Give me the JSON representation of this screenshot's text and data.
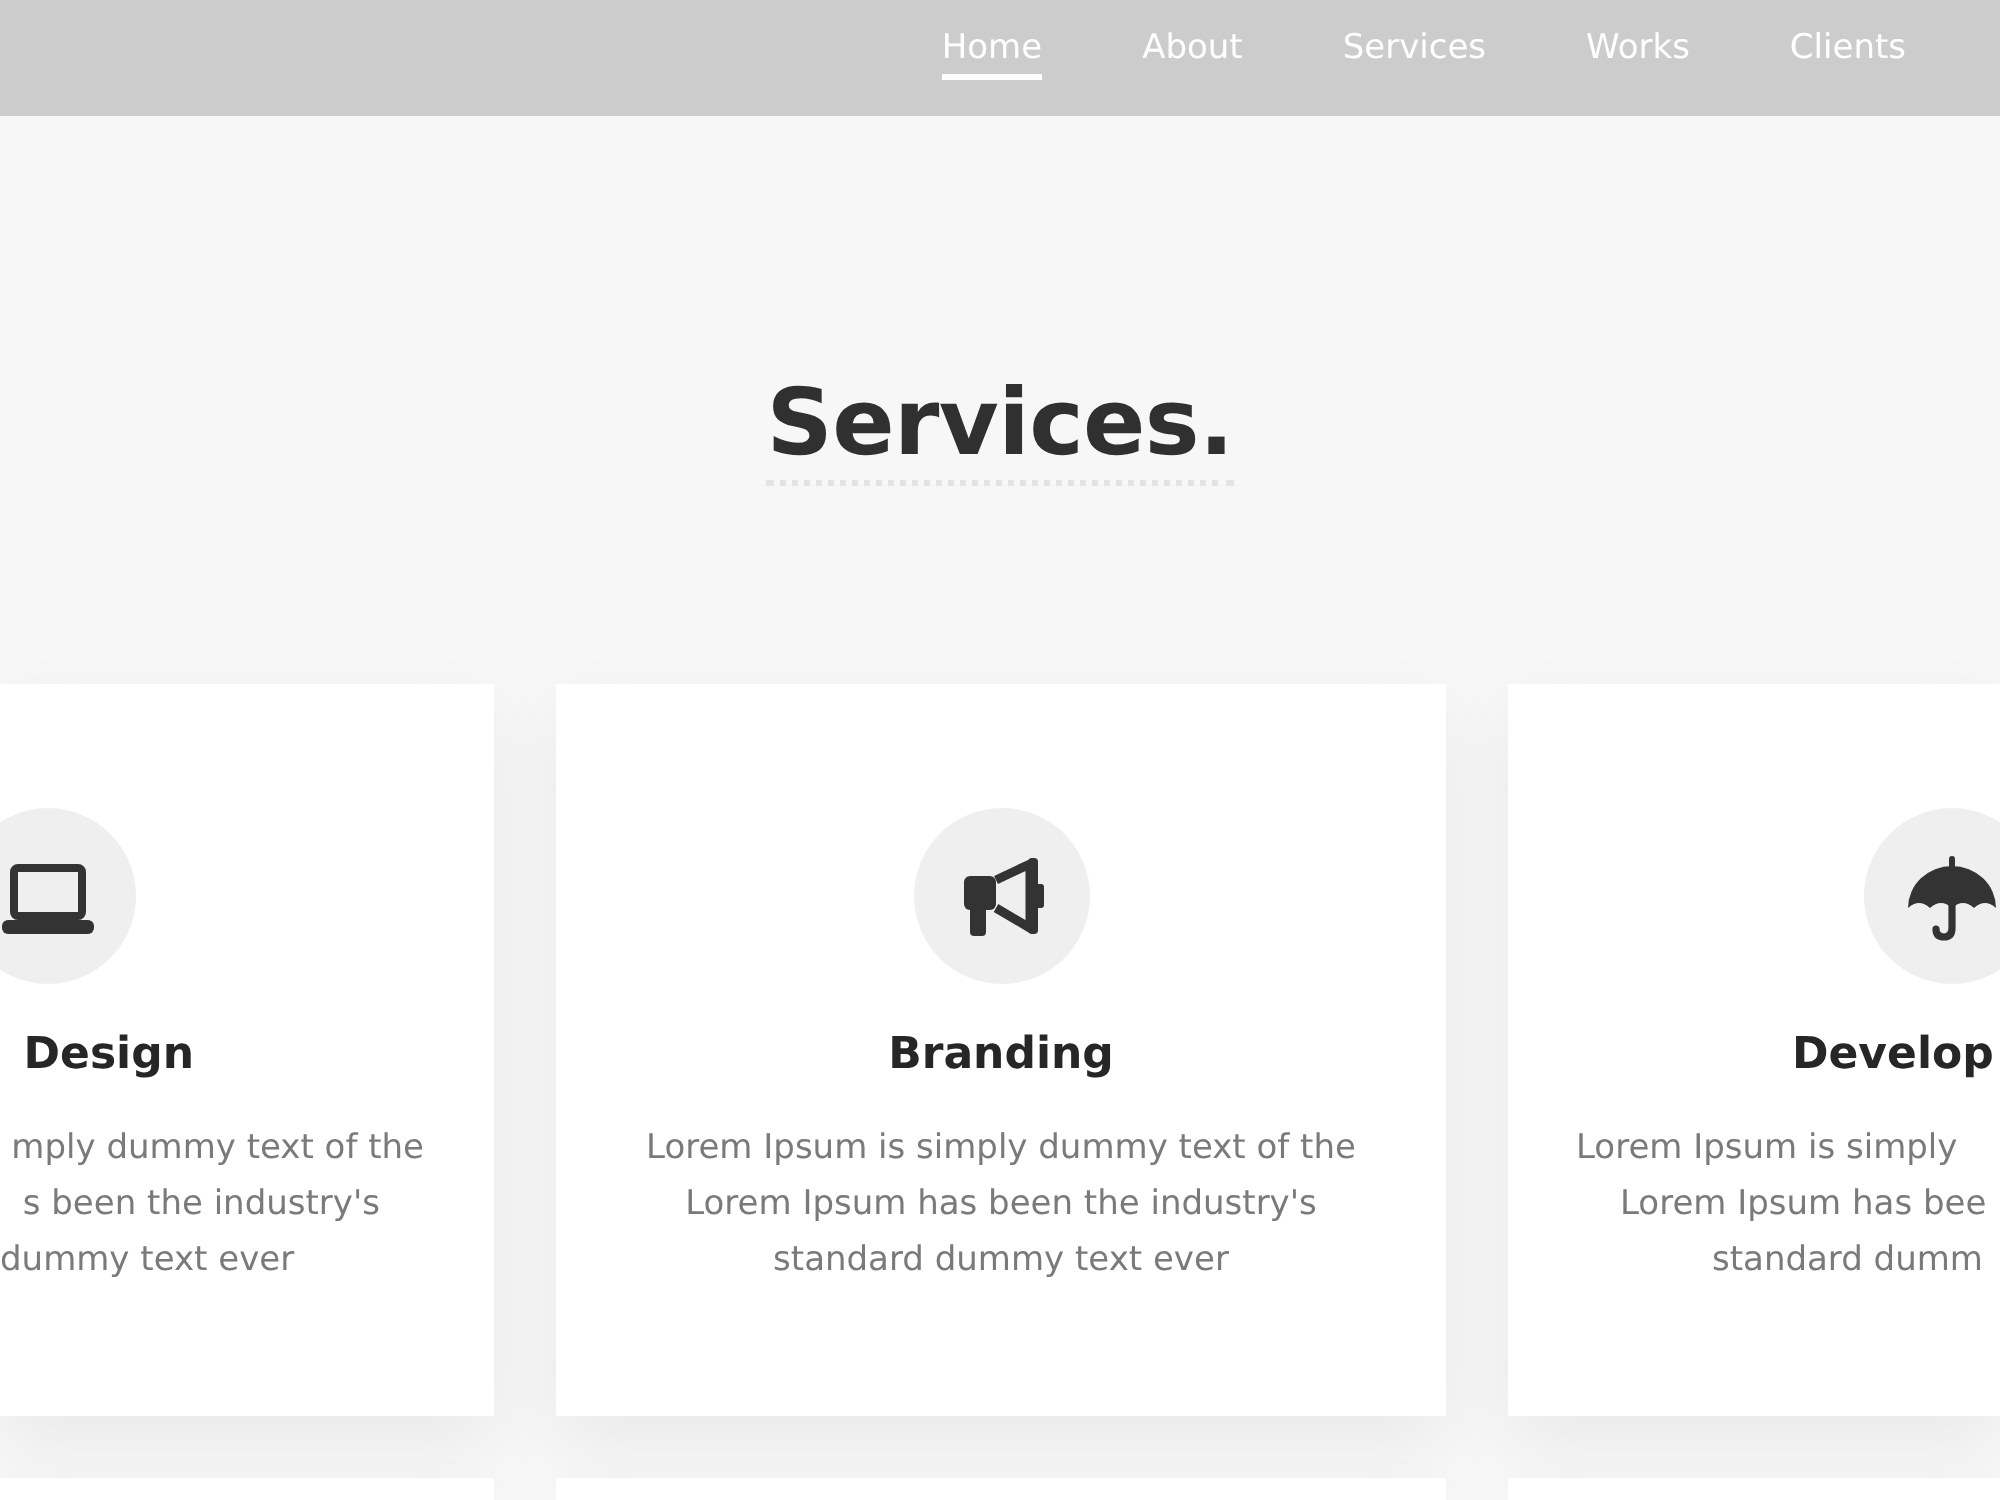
{
  "nav": {
    "items": [
      {
        "label": "Home",
        "selected": true
      },
      {
        "label": "About",
        "selected": false
      },
      {
        "label": "Services",
        "selected": false
      },
      {
        "label": "Works",
        "selected": false
      },
      {
        "label": "Clients",
        "selected": false
      }
    ]
  },
  "heading": {
    "title": "Services."
  },
  "cards": [
    {
      "kind": "cut-left",
      "title": "Design",
      "description_lines": [
        "mply dummy text of the",
        "s been the industry's",
        "dummy text ever"
      ]
    },
    {
      "kind": "full",
      "title": "Branding",
      "description_lines": [
        "Lorem Ipsum is simply dummy text of the",
        "Lorem Ipsum has been the industry's",
        "standard dummy text ever"
      ]
    },
    {
      "kind": "cut-right",
      "title": "Develop",
      "description_lines": [
        "Lorem Ipsum is simply",
        "Lorem Ipsum has bee",
        "standard dumm"
      ]
    }
  ]
}
